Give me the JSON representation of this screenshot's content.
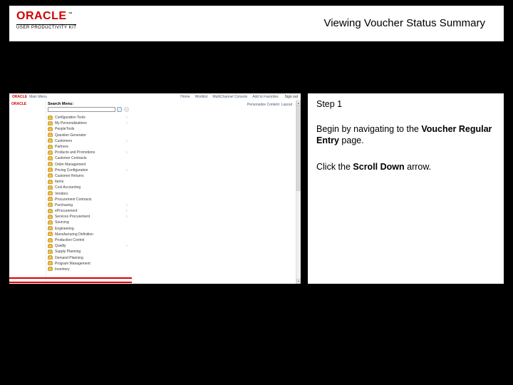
{
  "logo": {
    "brand": "ORACLE",
    "tm": "™",
    "tagline": "USER PRODUCTIVITY KIT"
  },
  "doc_title": "Viewing Voucher Status Summary",
  "step": {
    "label": "Step 1",
    "intro_prefix": "Begin by navigating to the ",
    "intro_bold": "Voucher Regular Entry",
    "intro_suffix": " page.",
    "action_prefix": "Click the ",
    "action_bold": "Scroll Down",
    "action_suffix": " arrow."
  },
  "screenshot": {
    "brand": "ORACLE",
    "topbar_user": "Main Menu",
    "topbar_links": [
      "Home",
      "Worklist",
      "MultiChannel Console",
      "Add to Favorites"
    ],
    "signout": "Sign out",
    "toggle": "‹‹",
    "search_label": "Search Menu:",
    "main_links": [
      "Personalize Content",
      "Layout"
    ],
    "menu": [
      "Configuration Tools",
      "My Personalizations",
      "PeopleTools",
      "Question Generator",
      "Customers",
      "Partners",
      "Products and Promotions",
      "Customer Contracts",
      "Order Management",
      "Pricing Configuration",
      "Customer Returns",
      "Items",
      "Cost Accounting",
      "Vendors",
      "Procurement Contracts",
      "Purchasing",
      "eProcurement",
      "Services Procurement",
      "Sourcing",
      "Engineering",
      "Manufacturing Definition",
      "Production Control",
      "Quality",
      "Supply Planning",
      "Demand Planning",
      "Program Management",
      "Inventory"
    ],
    "has_caret": [
      0,
      1,
      4,
      6,
      9,
      15,
      16,
      17,
      22
    ]
  }
}
